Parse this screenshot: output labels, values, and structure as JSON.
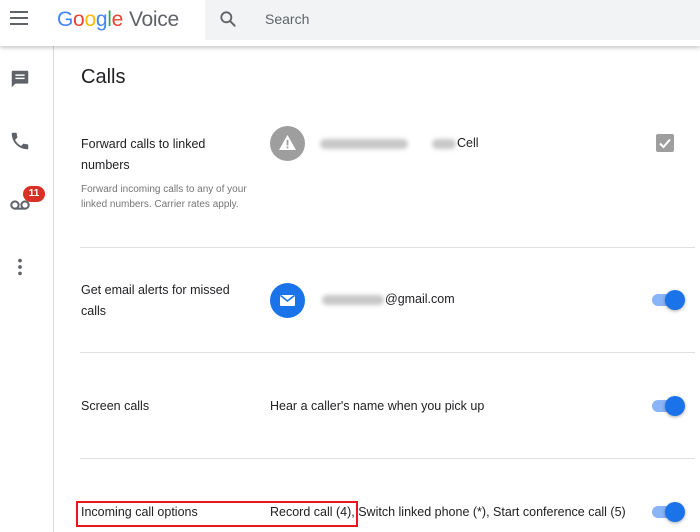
{
  "app": {
    "logo_letters": [
      "G",
      "o",
      "o",
      "g",
      "l",
      "e"
    ],
    "product": "Voice"
  },
  "search": {
    "placeholder": "Search"
  },
  "rail": {
    "items": [
      {
        "icon": "messages-icon"
      },
      {
        "icon": "calls-icon"
      },
      {
        "icon": "voicemail-icon",
        "badge": "11"
      },
      {
        "icon": "more-vert-icon"
      }
    ]
  },
  "main": {
    "title": "Calls",
    "settings": [
      {
        "title": "Forward calls to linked numbers",
        "subtitle": "Forward incoming calls to any of your linked numbers. Carrier rates apply.",
        "value_suffix": "Cell",
        "control": "checkbox",
        "checked": true
      },
      {
        "title": "Get email alerts for missed calls",
        "value_suffix": "@gmail.com",
        "control": "toggle",
        "on": true
      },
      {
        "title": "Screen calls",
        "value": "Hear a caller's name when you pick up",
        "control": "toggle",
        "on": true
      },
      {
        "title": "Incoming call options",
        "value": "Record call (4), Switch linked phone (*), Start conference call (5)",
        "control": "toggle",
        "on": true,
        "highlighted": true
      }
    ]
  },
  "colors": {
    "accent": "#1a73e8",
    "toggle_track": "#8ab4f8",
    "badge": "#d93025",
    "highlight_box": "#e8171f"
  }
}
